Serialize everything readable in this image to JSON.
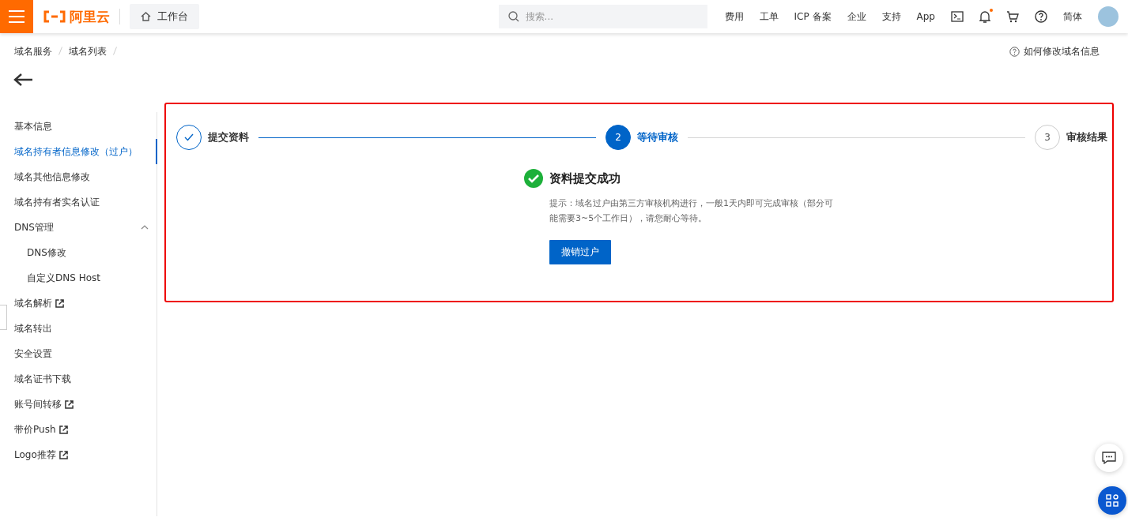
{
  "topbar": {
    "logo": "阿里云",
    "workbench": "工作台",
    "search": {
      "placeholder": "搜索..."
    },
    "links": [
      "费用",
      "工单",
      "ICP 备案",
      "企业",
      "支持",
      "App"
    ],
    "notification_dot": true,
    "language": "简体"
  },
  "breadcrumb": [
    "域名服务",
    "域名列表"
  ],
  "help_link": "如何修改域名信息",
  "sidebar": [
    {
      "label": "基本信息",
      "selected": false,
      "external": false
    },
    {
      "label": "域名持有者信息修改（过户）",
      "selected": true,
      "external": false
    },
    {
      "label": "域名其他信息修改",
      "selected": false,
      "external": false
    },
    {
      "label": "域名持有者实名认证",
      "selected": false,
      "external": false
    },
    {
      "label": "DNS管理",
      "selected": false,
      "external": false,
      "expanded": true,
      "children": [
        {
          "label": "DNS修改",
          "selected": false,
          "external": false
        },
        {
          "label": "自定义DNS Host",
          "selected": false,
          "external": false
        }
      ]
    },
    {
      "label": "域名解析",
      "selected": false,
      "external": true
    },
    {
      "label": "域名转出",
      "selected": false,
      "external": false
    },
    {
      "label": "安全设置",
      "selected": false,
      "external": false
    },
    {
      "label": "域名证书下载",
      "selected": false,
      "external": false
    },
    {
      "label": "账号间转移",
      "selected": false,
      "external": true
    },
    {
      "label": "带价Push",
      "selected": false,
      "external": true
    },
    {
      "label": "Logo推荐",
      "selected": false,
      "external": true
    }
  ],
  "steps": [
    {
      "label": "提交资料",
      "done": true,
      "current": false
    },
    {
      "number": "2",
      "label": "等待审核",
      "done": false,
      "current": true
    },
    {
      "number": "3",
      "label": "审核结果",
      "done": false,
      "current": false
    }
  ],
  "result": {
    "title": "资料提交成功",
    "hint": "提示：域名过户由第三方审核机构进行，一般1天内即可完成审核（部分可能需要3~5个工作日），请您耐心等待。",
    "button": "撤销过户"
  }
}
